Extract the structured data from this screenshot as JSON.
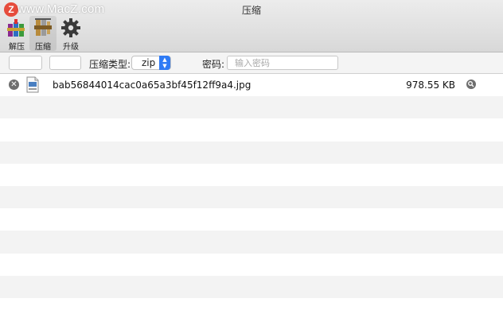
{
  "window": {
    "title": "压缩",
    "watermark": "www.MacZ.com",
    "watermark_badge": "Z"
  },
  "toolbar": {
    "items": [
      {
        "label": "解压",
        "icon": "rar-books-icon",
        "active": false
      },
      {
        "label": "压缩",
        "icon": "compress-icon",
        "active": true
      },
      {
        "label": "升级",
        "icon": "gear-icon",
        "active": false
      }
    ]
  },
  "options": {
    "format_label": "压缩类型:",
    "format_value": "zip",
    "password_label": "密码:",
    "password_placeholder": "输入密码"
  },
  "files": [
    {
      "name": "bab56844014cac0a65a3bf45f12ff9a4.jpg",
      "size": "978.55 KB",
      "type_icon": "jpeg-file-icon"
    }
  ],
  "colors": {
    "accent": "#2f7bf5",
    "badge": "#e64c3c",
    "row_alt": "#f3f3f3"
  }
}
